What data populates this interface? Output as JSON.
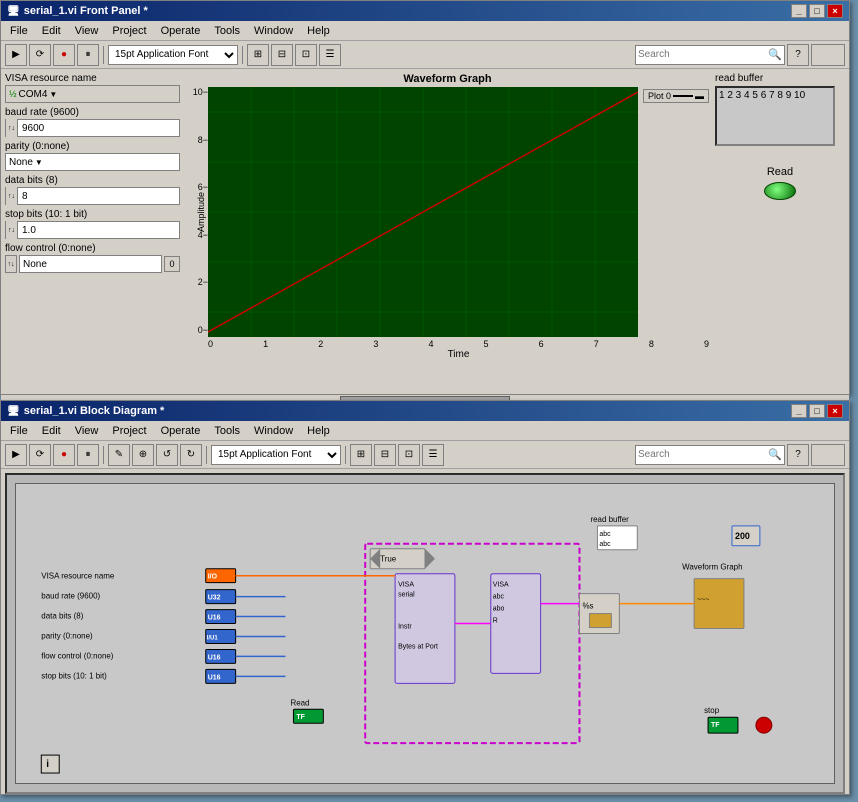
{
  "frontPanel": {
    "title": "serial_1.vi Front Panel *",
    "titleButtons": [
      "_",
      "□",
      "×"
    ],
    "menu": [
      "File",
      "Edit",
      "View",
      "Project",
      "Operate",
      "Tools",
      "Window",
      "Help"
    ],
    "toolbar": {
      "font": "15pt Application Font",
      "search": "Search"
    },
    "controls": {
      "visaLabel": "VISA resource name",
      "visaValue": "COM4",
      "baudLabel": "baud rate (9600)",
      "baudValue": "9600",
      "parityLabel": "parity (0:none)",
      "parityValue": "None",
      "dataBitsLabel": "data bits (8)",
      "dataBitsValue": "8",
      "stopBitsLabel": "stop bits (10: 1 bit)",
      "stopBitsValue": "1.0",
      "flowControlLabel": "flow control (0:none)",
      "flowControlValue": "None",
      "flowNumber": "0"
    },
    "graph": {
      "title": "Waveform Graph",
      "plotLabel": "Plot 0",
      "yAxisTitle": "Amplitude",
      "xAxisTitle": "Time",
      "xLabels": [
        "0",
        "1",
        "2",
        "3",
        "4",
        "5",
        "6",
        "7",
        "8",
        "9"
      ],
      "yLabels": [
        "10",
        "8",
        "6",
        "4",
        "2",
        "0"
      ]
    },
    "readBuffer": {
      "label": "read buffer",
      "value": "1 2 3 4 5 6 7 8 9 10"
    },
    "readButton": {
      "label": "Read"
    }
  },
  "blockDiagram": {
    "title": "serial_1.vi Block Diagram *",
    "titleButtons": [
      "_",
      "□",
      "×"
    ],
    "menu": [
      "File",
      "Edit",
      "View",
      "Project",
      "Operate",
      "Tools",
      "Window",
      "Help"
    ],
    "toolbar": {
      "font": "15pt Application Font",
      "search": "Search"
    },
    "nodes": {
      "visaResourceName": "VISA resource name",
      "baudRate": "baud rate (9600)",
      "dataBits": "data bits (8)",
      "parity": "parity (0:none)",
      "flowControl": "flow control (0:none)",
      "stopBits": "stop bits (10: 1 bit)",
      "readBuffer": "read buffer",
      "waveformGraph": "Waveform Graph",
      "readNode": "Read",
      "stopNode": "stop",
      "trueLabel": "True",
      "instrLabel": "Instr",
      "bytesAtPort": "Bytes at Port",
      "num200": "200"
    }
  }
}
